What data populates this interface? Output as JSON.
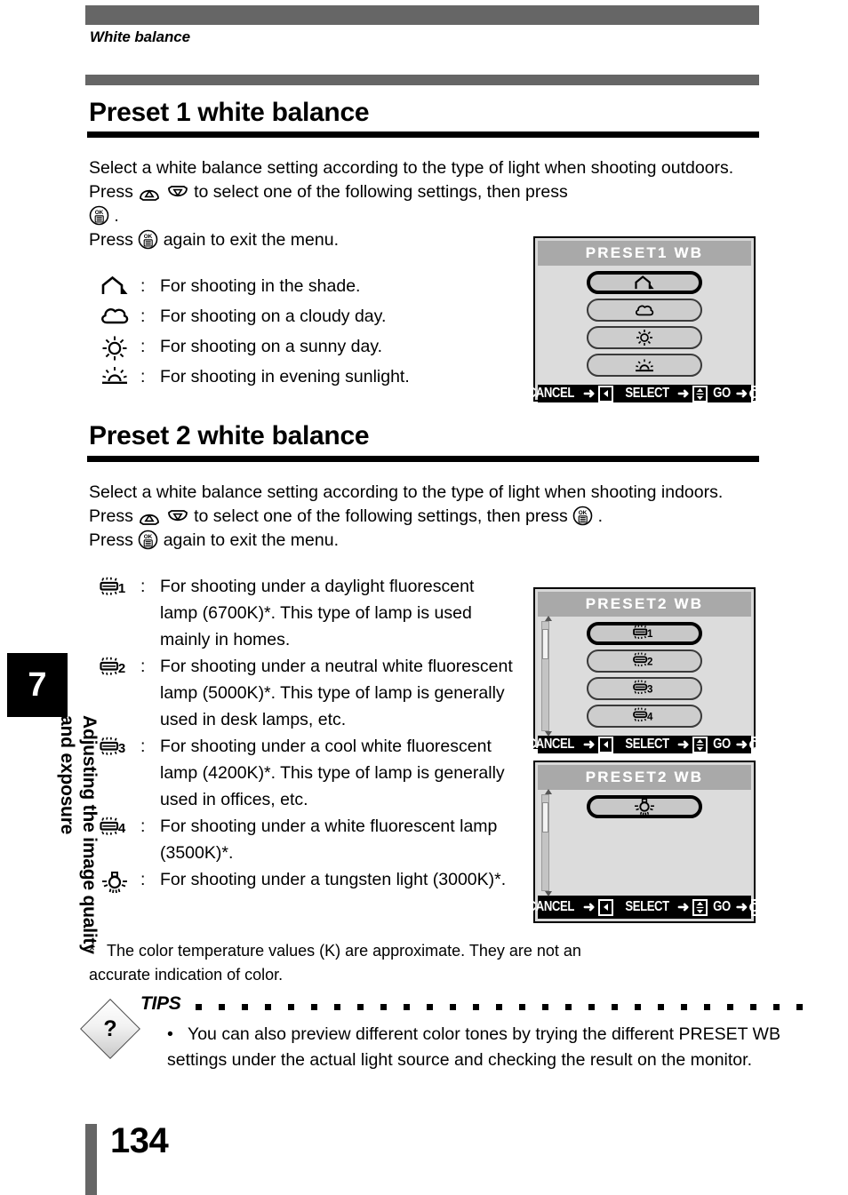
{
  "header": {
    "running_head": "White balance"
  },
  "sections": [
    {
      "id": "preset1",
      "heading": "Preset 1 white balance",
      "paragraph_a": "Select a white balance setting according to the type of light when shooting outdoors. Press",
      "paragraph_b": "to select one of the following settings, then press",
      "paragraph_c": ".",
      "paragraph_d_pre": "Press",
      "paragraph_d_post": "again to exit the menu.",
      "items": [
        {
          "icon": "shade-icon",
          "colon": ":",
          "text": "For shooting in the shade."
        },
        {
          "icon": "cloudy-icon",
          "colon": ":",
          "text": "For shooting on a cloudy day."
        },
        {
          "icon": "sunny-icon",
          "colon": ":",
          "text": "For shooting on a sunny day."
        },
        {
          "icon": "evening-sunlight-icon",
          "colon": ":",
          "text": "For shooting in evening sunlight."
        }
      ]
    },
    {
      "id": "preset2",
      "heading": "Preset 2 white balance",
      "paragraph_a": "Select a white balance setting according to the type of light when shooting indoors. Press",
      "paragraph_b": "to select one of the following settings, then press",
      "paragraph_c": ".",
      "paragraph_d_pre": "Press",
      "paragraph_d_post": "again to exit the menu.",
      "items": [
        {
          "icon": "fluorescent-1-icon",
          "colon": ":",
          "text": "For shooting under a daylight fluorescent lamp (6700K)*. This type of lamp is used mainly in homes."
        },
        {
          "icon": "fluorescent-2-icon",
          "colon": ":",
          "text": "For shooting under a neutral white fluorescent lamp (5000K)*. This type of lamp is generally used in desk lamps, etc."
        },
        {
          "icon": "fluorescent-3-icon",
          "colon": ":",
          "text": "For shooting under a cool white fluorescent lamp (4200K)*. This type of lamp is generally used in offices, etc."
        },
        {
          "icon": "fluorescent-4-icon",
          "colon": ":",
          "text": "For shooting under a white fluorescent lamp (3500K)*."
        },
        {
          "icon": "tungsten-icon",
          "colon": ":",
          "text": "For shooting under a tungsten light (3000K)*."
        }
      ]
    }
  ],
  "lcd_screens": [
    {
      "id": "preset1-wb",
      "title": "PRESET1 WB",
      "has_scrollbar": false,
      "options": [
        {
          "icon": "shade-icon",
          "selected": true
        },
        {
          "icon": "cloudy-icon",
          "selected": false
        },
        {
          "icon": "sunny-icon",
          "selected": false
        },
        {
          "icon": "evening-sunlight-icon",
          "selected": false
        }
      ],
      "footer": {
        "cancel_label": "CANCEL",
        "cancel_arrow": "➜",
        "cancel_key": "◀",
        "select_label": "SELECT",
        "select_arrow": "➜",
        "select_key": "▲▼",
        "go_label": "GO",
        "go_arrow": "➜",
        "go_key": "OK"
      }
    },
    {
      "id": "preset2-wb-page1",
      "title": "PRESET2 WB",
      "has_scrollbar": true,
      "options": [
        {
          "icon": "fluorescent-1-icon",
          "selected": true
        },
        {
          "icon": "fluorescent-2-icon",
          "selected": false
        },
        {
          "icon": "fluorescent-3-icon",
          "selected": false
        },
        {
          "icon": "fluorescent-4-icon",
          "selected": false
        }
      ],
      "footer": {
        "cancel_label": "CANCEL",
        "cancel_arrow": "➜",
        "cancel_key": "◀",
        "select_label": "SELECT",
        "select_arrow": "➜",
        "select_key": "▲▼",
        "go_label": "GO",
        "go_arrow": "➜",
        "go_key": "OK"
      }
    },
    {
      "id": "preset2-wb-page2",
      "title": "PRESET2 WB",
      "has_scrollbar": true,
      "options": [
        {
          "icon": "tungsten-icon",
          "selected": true
        }
      ],
      "footer": {
        "cancel_label": "CANCEL",
        "cancel_arrow": "➜",
        "cancel_key": "◀",
        "select_label": "SELECT",
        "select_arrow": "➜",
        "select_key": "▲▼",
        "go_label": "GO",
        "go_arrow": "➜",
        "go_key": "OK"
      }
    }
  ],
  "footnote": {
    "marker": "*",
    "text": "The color temperature values (K) are approximate. They are not an accurate indication of color."
  },
  "tips": {
    "label": "TIPS",
    "icon": "question-diamond-icon",
    "question_mark": "?",
    "bullet": "•",
    "text": "You can also preview different color tones by trying the different PRESET WB settings under the actual light source and checking the result on the monitor."
  },
  "sidebar": {
    "chapter_number": "7",
    "chapter_title": "Adjusting the image quality and exposure"
  },
  "page_number": "134",
  "colors": {
    "rule_gray": "#666666",
    "rule_black": "#000000",
    "lcd_title_band": "#a9a9a9",
    "lcd_body": "#dcdcdc",
    "lcd_footer": "#000000"
  }
}
